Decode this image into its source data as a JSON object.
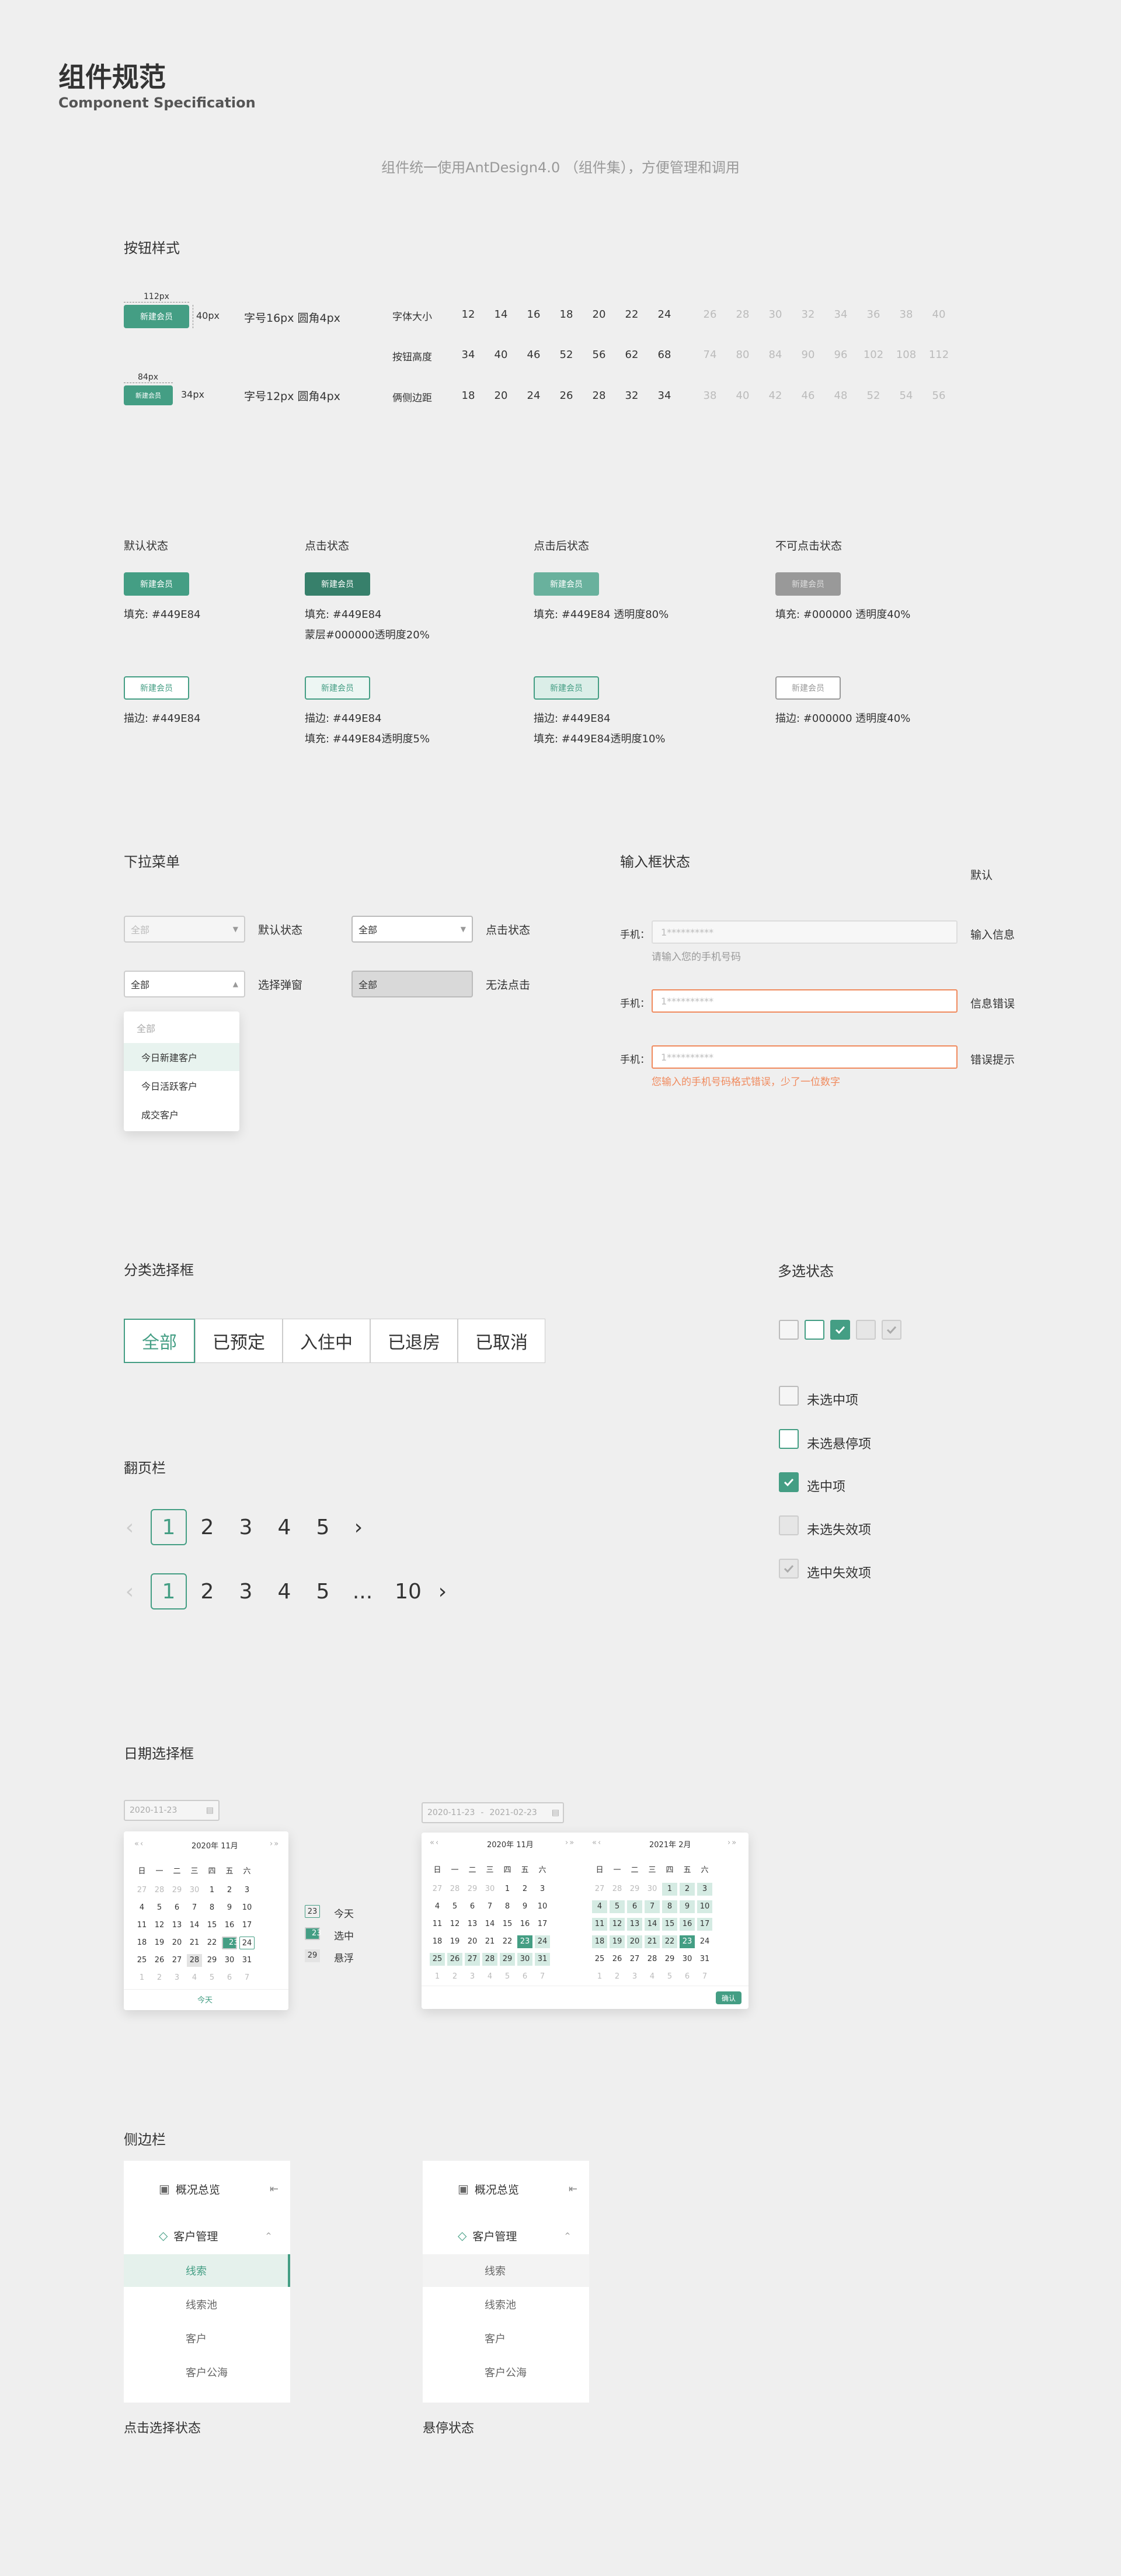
{
  "page": {
    "title": "组件规范",
    "subtitle": "Component Specification",
    "intro": "组件统一使用AntDesign4.0 （组件集），方便管理和调用"
  },
  "colors": {
    "primary": "#449e84",
    "error": "#f08a5d",
    "black": "#000000"
  },
  "buttons": {
    "section_title": "按钮样式",
    "btn_label": "新建会员",
    "large": {
      "width_label": "112px",
      "height_label": "40px",
      "desc": "字号16px 圆角4px"
    },
    "small": {
      "width_label": "84px",
      "height_label": "34px",
      "desc": "字号12px 圆角4px"
    },
    "table": {
      "rows": [
        {
          "label": "字体大小",
          "active": [
            "12",
            "14",
            "16",
            "18",
            "20",
            "22",
            "24"
          ],
          "inactive": [
            "26",
            "28",
            "30",
            "32",
            "34",
            "36",
            "38",
            "40"
          ]
        },
        {
          "label": "按钮高度",
          "active": [
            "34",
            "40",
            "46",
            "52",
            "56",
            "62",
            "68"
          ],
          "inactive": [
            "74",
            "80",
            "84",
            "90",
            "96",
            "102",
            "108",
            "112"
          ]
        },
        {
          "label": "俩侧边距",
          "active": [
            "18",
            "20",
            "24",
            "26",
            "28",
            "32",
            "34"
          ],
          "inactive": [
            "38",
            "40",
            "42",
            "46",
            "48",
            "52",
            "54",
            "56"
          ]
        }
      ]
    },
    "states": [
      {
        "title": "默认状态",
        "fill_desc": [
          "填充: #449E84"
        ],
        "outline_desc": [
          "描边: #449E84"
        ]
      },
      {
        "title": "点击状态",
        "fill_desc": [
          "填充: #449E84",
          "蒙层#000000透明度20%"
        ],
        "outline_desc": [
          "描边: #449E84",
          "填充: #449E84透明度5%"
        ]
      },
      {
        "title": "点击后状态",
        "fill_desc": [
          "填充: #449E84  透明度80%"
        ],
        "outline_desc": [
          "描边: #449E84",
          "填充: #449E84透明度10%"
        ]
      },
      {
        "title": "不可点击状态",
        "fill_desc": [
          "填充: #000000  透明度40%"
        ],
        "outline_desc": [
          "描边: #000000  透明度40%"
        ]
      }
    ]
  },
  "dropdown": {
    "section_title": "下拉菜单",
    "value": "全部",
    "default_label": "默认状态",
    "click_label": "点击状态",
    "popup_label": "选择弹窗",
    "disabled_label": "无法点击",
    "options": [
      "全部",
      "今日新建客户",
      "今日活跃客户",
      "成交客户"
    ]
  },
  "input": {
    "section_title": "输入框状态",
    "default_label": "默认",
    "field_label": "手机：",
    "placeholder": "1**********",
    "hint": "请输入您的手机号码",
    "error_msg": "您输入的手机号码格式错误，少了一位数字",
    "states": [
      "输入信息",
      "信息错误",
      "错误提示"
    ]
  },
  "segmented": {
    "section_title": "分类选择框",
    "items": [
      "全部",
      "已预定",
      "入住中",
      "已退房",
      "已取消"
    ]
  },
  "checkbox": {
    "section_title": "多选状态",
    "items": [
      "未选中项",
      "未选悬停项",
      "选中项",
      "未选失效项",
      "选中失效项"
    ]
  },
  "pagination": {
    "section_title": "翻页栏",
    "row1": [
      "1",
      "2",
      "3",
      "4",
      "5"
    ],
    "row2": [
      "1",
      "2",
      "3",
      "4",
      "5",
      "...",
      "10"
    ]
  },
  "datepicker": {
    "section_title": "日期选择框",
    "single_value": "2020-11-23",
    "range_start": "2020-11-23",
    "range_sep": "-",
    "range_end": "2021-02-23",
    "month1": "2020年  11月",
    "month2": "2021年  2月",
    "weekdays": [
      "日",
      "一",
      "二",
      "三",
      "四",
      "五",
      "六"
    ],
    "today_btn": "今天",
    "confirm_btn": "确认",
    "legend": [
      {
        "num": "23",
        "label": "今天"
      },
      {
        "num": "23",
        "label": "选中"
      },
      {
        "num": "29",
        "label": "悬浮"
      }
    ],
    "nov_days": [
      "27",
      "28",
      "29",
      "30",
      "1",
      "2",
      "3",
      "4",
      "5",
      "6",
      "7",
      "8",
      "9",
      "10",
      "11",
      "12",
      "13",
      "14",
      "15",
      "16",
      "17",
      "18",
      "19",
      "20",
      "21",
      "22",
      "23",
      "24",
      "25",
      "26",
      "27",
      "28",
      "29",
      "30",
      "31",
      "1",
      "2",
      "3",
      "4",
      "5",
      "6",
      "7"
    ],
    "feb_days": [
      "27",
      "28",
      "29",
      "30",
      "1",
      "2",
      "3",
      "4",
      "5",
      "6",
      "7",
      "8",
      "9",
      "10",
      "11",
      "12",
      "13",
      "14",
      "15",
      "16",
      "17",
      "18",
      "19",
      "20",
      "21",
      "22",
      "23",
      "24",
      "25",
      "26",
      "27",
      "28",
      "29",
      "30",
      "31",
      "1",
      "2",
      "3",
      "4",
      "5",
      "6",
      "7"
    ]
  },
  "sidebar": {
    "section_title": "侧边栏",
    "overview": "概况总览",
    "customer_mgmt": "客户管理",
    "sub_items": [
      "线索",
      "线索池",
      "客户",
      "客户公海"
    ],
    "click_caption": "点击选择状态",
    "hover_caption": "悬停状态"
  }
}
